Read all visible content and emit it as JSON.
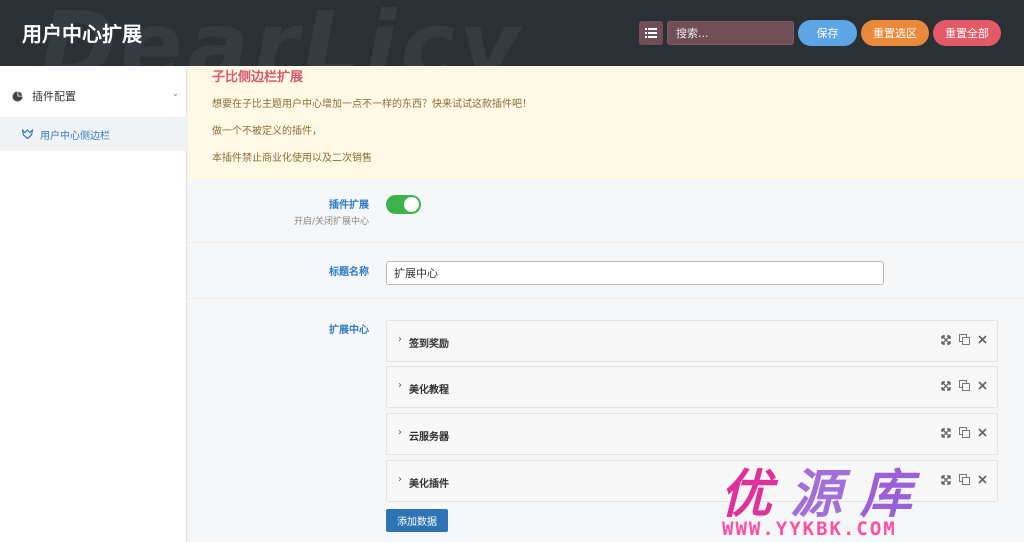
{
  "header": {
    "watermark": "DearLicy",
    "title": "用户中心扩展",
    "search_placeholder": "搜索...",
    "save_label": "保存",
    "reset_section_label": "重置选区",
    "reset_all_label": "重置全部"
  },
  "sidebar": {
    "group_label": "插件配置",
    "sub_item_label": "用户中心侧边栏"
  },
  "notice": {
    "title": "子比侧边栏扩展",
    "lines": [
      "想要在子比主题用户中心增加一点不一样的东西？快来试试这款插件吧！",
      "做一个不被定义的插件，",
      "本插件禁止商业化使用以及二次销售"
    ]
  },
  "fields": {
    "plugin_ext": {
      "label": "插件扩展",
      "sublabel": "开启/关闭扩展中心",
      "enabled": true
    },
    "title_name": {
      "label": "标题名称",
      "value": "扩展中心"
    },
    "ext_center": {
      "label": "扩展中心",
      "items": [
        "签到奖励",
        "美化教程",
        "云服务器",
        "美化插件"
      ],
      "add_label": "添加数据"
    }
  },
  "brand": {
    "chars": [
      "优",
      "源",
      "库"
    ],
    "url": "WWW.YYKBK.COM"
  },
  "colors": {
    "header_bg": "#2b3035",
    "accent_blue": "#2e7cc4",
    "save": "#5da6e6",
    "reset_section": "#e98a3a",
    "reset_all": "#e25a68",
    "toggle_on": "#3cb34a",
    "notice_bg": "#fff9e6",
    "notice_title": "#d65a6a"
  }
}
